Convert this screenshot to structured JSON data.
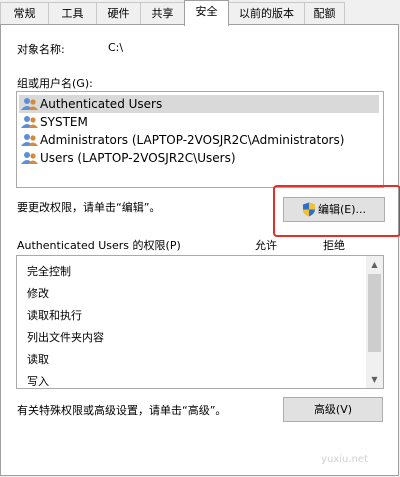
{
  "tabs": [
    {
      "label": "常规"
    },
    {
      "label": "工具"
    },
    {
      "label": "硬件"
    },
    {
      "label": "共享"
    },
    {
      "label": "安全"
    },
    {
      "label": "以前的版本"
    },
    {
      "label": "配额"
    }
  ],
  "object": {
    "label": "对象名称:",
    "value": "C:\\"
  },
  "groups": {
    "label": "组或用户名(G):",
    "items": [
      {
        "label": "Authenticated Users"
      },
      {
        "label": "SYSTEM"
      },
      {
        "label": "Administrators (LAPTOP-2VOSJR2C\\Administrators)"
      },
      {
        "label": "Users (LAPTOP-2VOSJR2C\\Users)"
      }
    ]
  },
  "change_hint": "要更改权限，请单击“编辑”。",
  "edit_button": "编辑(E)...",
  "permissions": {
    "title": "Authenticated Users 的权限(P)",
    "allow_header": "允许",
    "deny_header": "拒绝",
    "items": [
      {
        "label": "完全控制"
      },
      {
        "label": "修改"
      },
      {
        "label": "读取和执行"
      },
      {
        "label": "列出文件夹内容"
      },
      {
        "label": "读取"
      },
      {
        "label": "写入"
      }
    ]
  },
  "advanced_hint": "有关特殊权限或高级设置，请单击“高级”。",
  "advanced_button": "高级(V)",
  "watermark": "yuxiu.net",
  "colors": {
    "highlight": "#e0302a",
    "selected_row": "#d9d9d9"
  }
}
